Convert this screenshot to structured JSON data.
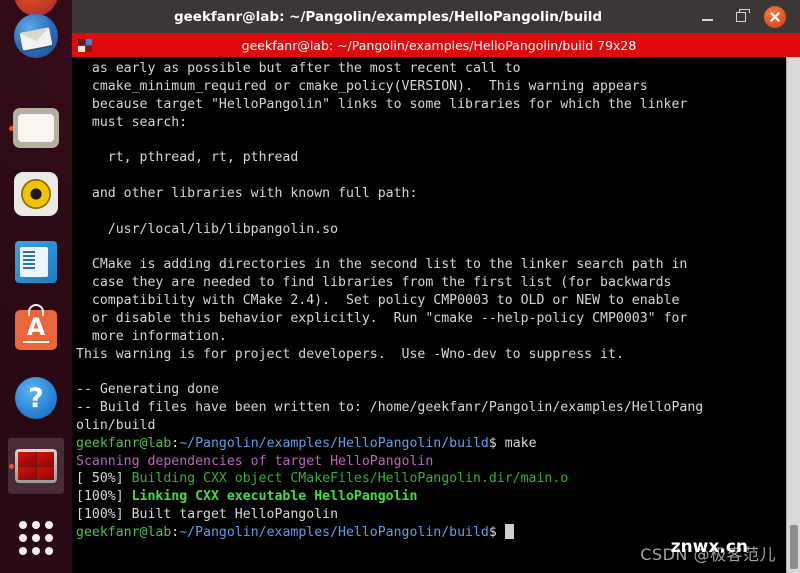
{
  "window": {
    "title": "geekfanr@lab: ~/Pangolin/examples/HelloPangolin/build",
    "minimize_label": "",
    "maximize_label": "",
    "close_label": ""
  },
  "tab": {
    "label": "geekfanr@lab: ~/Pangolin/examples/HelloPangolin/build 79x28",
    "icon": "terminal-icon",
    "bar_color": "#dd0b0b"
  },
  "launcher": {
    "items": [
      {
        "name": "ubuntu-logo",
        "label": "Ubuntu"
      },
      {
        "name": "thunderbird",
        "label": "Thunderbird Mail"
      },
      {
        "name": "files",
        "label": "Files"
      },
      {
        "name": "rhythmbox",
        "label": "Rhythmbox"
      },
      {
        "name": "libreoffice-writer",
        "label": "LibreOffice Writer"
      },
      {
        "name": "ubuntu-software",
        "label": "Ubuntu Software",
        "glyph": "A"
      },
      {
        "name": "help",
        "label": "Help",
        "glyph": "?"
      },
      {
        "name": "terminal",
        "label": "Terminal"
      },
      {
        "name": "show-applications",
        "label": "Show Applications"
      }
    ]
  },
  "terminal": {
    "columns": 79,
    "rows": 28,
    "background": "#000000",
    "foreground": "#d8d8d8",
    "lines": [
      {
        "segments": [
          {
            "text": "  as early as possible but after the most recent call to",
            "color": "white"
          }
        ]
      },
      {
        "segments": [
          {
            "text": "  cmake_minimum_required or cmake_policy(VERSION).  This warning appears",
            "color": "white"
          }
        ]
      },
      {
        "segments": [
          {
            "text": "  because target \"HelloPangolin\" links to some libraries for which the linker",
            "color": "white"
          }
        ]
      },
      {
        "segments": [
          {
            "text": "  must search:",
            "color": "white"
          }
        ]
      },
      {
        "segments": [
          {
            "text": "",
            "color": "white"
          }
        ]
      },
      {
        "segments": [
          {
            "text": "    rt, pthread, rt, pthread",
            "color": "white"
          }
        ]
      },
      {
        "segments": [
          {
            "text": "",
            "color": "white"
          }
        ]
      },
      {
        "segments": [
          {
            "text": "  and other libraries with known full path:",
            "color": "white"
          }
        ]
      },
      {
        "segments": [
          {
            "text": "",
            "color": "white"
          }
        ]
      },
      {
        "segments": [
          {
            "text": "    /usr/local/lib/libpangolin.so",
            "color": "white"
          }
        ]
      },
      {
        "segments": [
          {
            "text": "",
            "color": "white"
          }
        ]
      },
      {
        "segments": [
          {
            "text": "  CMake is adding directories in the second list to the linker search path in",
            "color": "white"
          }
        ]
      },
      {
        "segments": [
          {
            "text": "  case they are needed to find libraries from the first list (for backwards",
            "color": "white"
          }
        ]
      },
      {
        "segments": [
          {
            "text": "  compatibility with CMake 2.4).  Set policy CMP0003 to OLD or NEW to enable",
            "color": "white"
          }
        ]
      },
      {
        "segments": [
          {
            "text": "  or disable this behavior explicitly.  Run \"cmake --help-policy CMP0003\" for",
            "color": "white"
          }
        ]
      },
      {
        "segments": [
          {
            "text": "  more information.",
            "color": "white"
          }
        ]
      },
      {
        "segments": [
          {
            "text": "This warning is for project developers.  Use -Wno-dev to suppress it.",
            "color": "white"
          }
        ]
      },
      {
        "segments": [
          {
            "text": "",
            "color": "white"
          }
        ]
      },
      {
        "segments": [
          {
            "text": "-- Generating done",
            "color": "white"
          }
        ]
      },
      {
        "segments": [
          {
            "text": "-- Build files have been written to: /home/geekfanr/Pangolin/examples/HelloPang",
            "color": "white"
          }
        ]
      },
      {
        "segments": [
          {
            "text": "olin/build",
            "color": "white"
          }
        ]
      },
      {
        "segments": [
          {
            "text": "geekfanr@lab",
            "color": "green"
          },
          {
            "text": ":",
            "color": "white"
          },
          {
            "text": "~/Pangolin/examples/HelloPangolin/build",
            "color": "blue"
          },
          {
            "text": "$ make",
            "color": "white"
          }
        ]
      },
      {
        "segments": [
          {
            "text": "Scanning dependencies of target HelloPangolin",
            "color": "magenta"
          }
        ]
      },
      {
        "segments": [
          {
            "text": "[ 50%] ",
            "color": "white"
          },
          {
            "text": "Building CXX object CMakeFiles/HelloPangolin.dir/main.o",
            "color": "green2"
          }
        ]
      },
      {
        "segments": [
          {
            "text": "[100%] ",
            "color": "white"
          },
          {
            "text": "Linking CXX executable HelloPangolin",
            "color": "bgreen"
          }
        ]
      },
      {
        "segments": [
          {
            "text": "[100%] Built target HelloPangolin",
            "color": "white"
          }
        ]
      },
      {
        "segments": [
          {
            "text": "geekfanr@lab",
            "color": "green"
          },
          {
            "text": ":",
            "color": "white"
          },
          {
            "text": "~/Pangolin/examples/HelloPangolin/build",
            "color": "blue"
          },
          {
            "text": "$ ",
            "color": "white"
          },
          {
            "text": "",
            "color": "cursor"
          }
        ]
      }
    ]
  },
  "scrollbar": {
    "name": "terminal-scrollbar",
    "position": "bottom"
  },
  "watermark": {
    "text": "CSDN @极客范儿",
    "overlay": "znwx.cn"
  },
  "colors": {
    "titlebar": "#3b3736",
    "tabbar": "#dd0b0b",
    "close_button": "#e2552b",
    "terminal_bg": "#000000",
    "prompt_user": "#4ec04e",
    "prompt_path": "#5c9fe8",
    "scanning": "#c060c0",
    "building": "#32b232",
    "linking": "#3ee03e"
  }
}
